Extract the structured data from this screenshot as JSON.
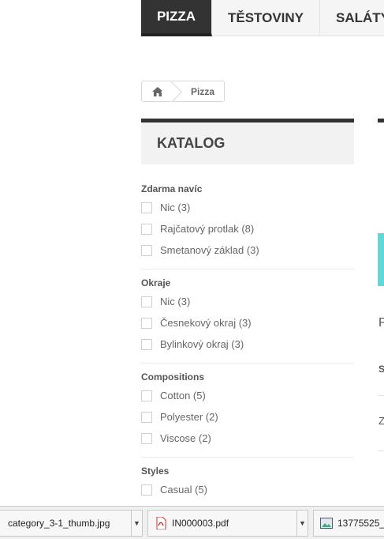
{
  "nav": {
    "tabs": [
      {
        "label": "PIZZA",
        "active": true
      },
      {
        "label": "TĚSTOVINY",
        "active": false
      },
      {
        "label": "SALÁTY",
        "active": false
      }
    ]
  },
  "breadcrumb": {
    "home_icon": "home-icon",
    "current": "Pizza"
  },
  "catalog": {
    "title": "KATALOG",
    "groups": [
      {
        "title": "Zdarma navíc",
        "options": [
          "Nic (3)",
          "Rajčatový protlak (8)",
          "Smetanový základ (3)"
        ]
      },
      {
        "title": "Okraje",
        "options": [
          "Nic (3)",
          "Česnekový okraj (3)",
          "Bylinkový okraj (3)"
        ]
      },
      {
        "title": "Compositions",
        "options": [
          "Cotton (5)",
          "Polyester (2)",
          "Viscose (2)"
        ]
      },
      {
        "title": "Styles",
        "options": [
          "Casual (5)"
        ]
      }
    ]
  },
  "right_fragments": {
    "letters": [
      "P",
      "S",
      "Z"
    ],
    "accent": "#5fd8d8"
  },
  "downloads": {
    "items": [
      {
        "name": "category_3-1_thumb.jpg",
        "icon": "none"
      },
      {
        "name": "IN000003.pdf",
        "icon": "pdf-icon"
      },
      {
        "name": "13775525_",
        "icon": "image-icon"
      }
    ]
  },
  "colors": {
    "active_tab": "#333333",
    "tab_bg": "#f5f5f5",
    "catalog_border": "#333333",
    "catalog_bg": "#f2f2f2"
  }
}
